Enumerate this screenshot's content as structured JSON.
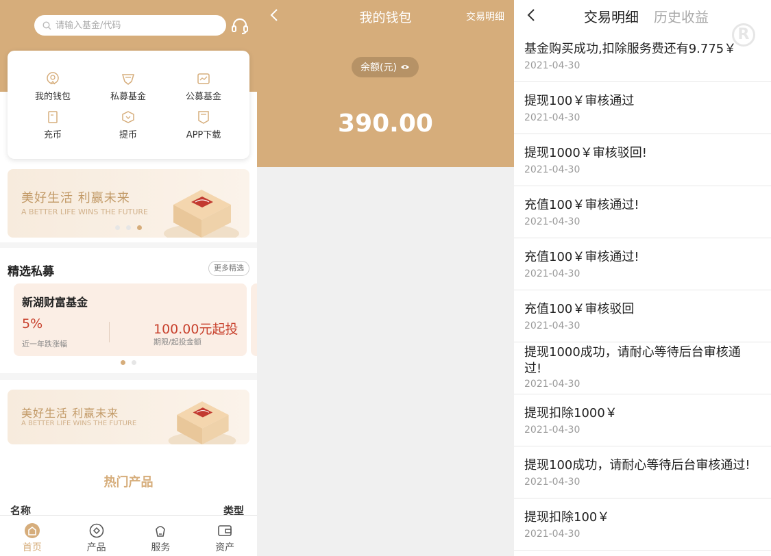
{
  "home": {
    "search_placeholder": "请输入基金/代码",
    "grid": [
      {
        "label": "我的钱包",
        "icon": "wallet-icon"
      },
      {
        "label": "私募基金",
        "icon": "gem-icon"
      },
      {
        "label": "公募基金",
        "icon": "chart-icon"
      },
      {
        "label": "充币",
        "icon": "deposit-icon"
      },
      {
        "label": "提币",
        "icon": "withdraw-icon"
      },
      {
        "label": "APP下载",
        "icon": "download-icon"
      }
    ],
    "banner": {
      "title": "美好生活 利赢未来",
      "subtitle": "A BETTER LIFE WINS THE FUTURE"
    },
    "section_title": "精选私募",
    "more_label": "更多精选",
    "fund": {
      "name": "新湖财富基金",
      "rate": "5%",
      "rate_label": "近一年跌涨幅",
      "amount": "100.00元起投",
      "amount_label": "期限/起投金额"
    },
    "banner2": {
      "title": "美好生活 利赢未来",
      "subtitle": "A BETTER LIFE WINS THE FUTURE"
    },
    "hot_title": "热门产品",
    "table_headers": [
      "名称",
      "类型"
    ],
    "tabs": [
      {
        "label": "首页",
        "icon": "home-icon"
      },
      {
        "label": "产品",
        "icon": "product-icon"
      },
      {
        "label": "服务",
        "icon": "service-icon"
      },
      {
        "label": "资产",
        "icon": "asset-icon"
      }
    ],
    "colors": {
      "accent": "#d6ad7b",
      "red": "#c8412d"
    }
  },
  "wallet": {
    "title": "我的钱包",
    "link": "交易明细",
    "balance_label": "余额(元)",
    "balance": "390.00"
  },
  "transactions": {
    "tab_active": "交易明细",
    "tab_inactive": "历史收益",
    "items": [
      {
        "text": "基金购买成功,扣除服务费还有9.775￥",
        "date": "2021-04-30"
      },
      {
        "text": "提现100￥审核通过",
        "date": "2021-04-30"
      },
      {
        "text": "提现1000￥审核驳回!",
        "date": "2021-04-30"
      },
      {
        "text": "充值100￥审核通过!",
        "date": "2021-04-30"
      },
      {
        "text": "充值100￥审核通过!",
        "date": "2021-04-30"
      },
      {
        "text": "充值100￥审核驳回",
        "date": "2021-04-30"
      },
      {
        "text": "提现1000成功，请耐心等待后台审核通过!",
        "date": "2021-04-30"
      },
      {
        "text": "提现扣除1000￥",
        "date": "2021-04-30"
      },
      {
        "text": "提现100成功，请耐心等待后台审核通过!",
        "date": "2021-04-30"
      },
      {
        "text": "提现扣除100￥",
        "date": "2021-04-30"
      }
    ]
  }
}
